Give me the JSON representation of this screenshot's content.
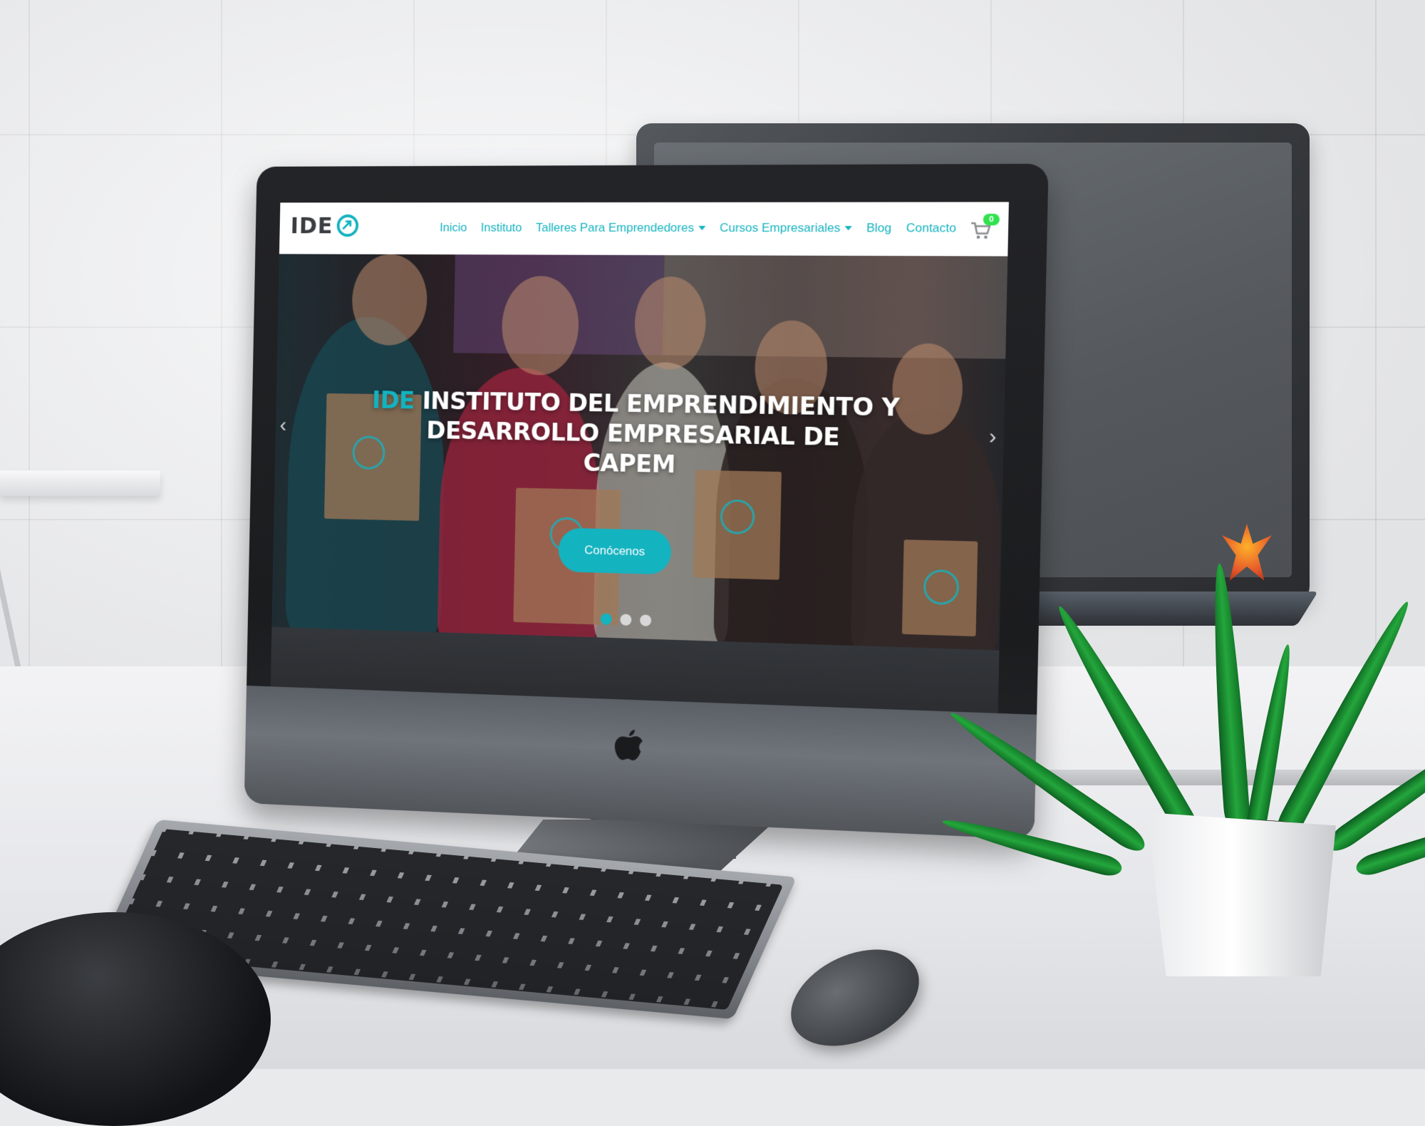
{
  "site": {
    "logo_text": "IDE",
    "nav": [
      {
        "label": "Inicio",
        "dropdown": false
      },
      {
        "label": "Instituto",
        "dropdown": false
      },
      {
        "label": "Talleres Para Emprendedores",
        "dropdown": true
      },
      {
        "label": "Cursos Empresariales",
        "dropdown": true
      },
      {
        "label": "Blog",
        "dropdown": false
      },
      {
        "label": "Contacto",
        "dropdown": false
      }
    ],
    "cart_count": "0",
    "hero": {
      "title_accent": "IDE",
      "title_line1": " INSTITUTO DEL EMPRENDIMIENTO Y",
      "title_line2": "DESARROLLO EMPRESARIAL DE",
      "title_line3": "CAPEM",
      "button_label": "Conócenos",
      "slides": 3,
      "active_slide": 1
    }
  },
  "colors": {
    "accent": "#14b3c0",
    "cart_badge": "#31e24e"
  },
  "icons": {
    "logo_mark": "ide-logo-icon",
    "cart": "cart-icon",
    "prev": "chevron-left-icon",
    "next": "chevron-right-icon"
  }
}
